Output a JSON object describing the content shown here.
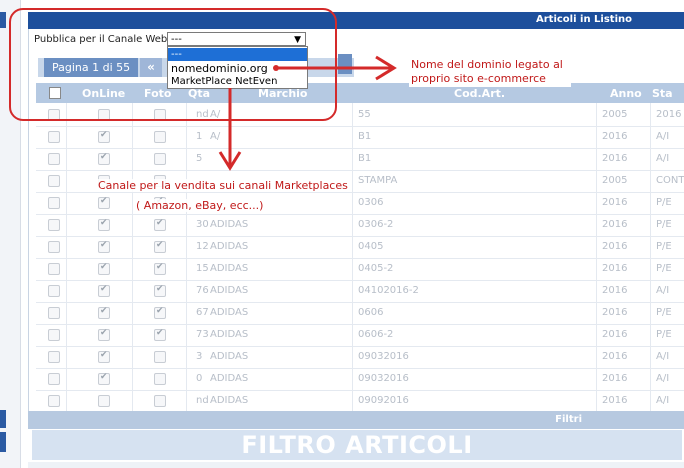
{
  "header": {
    "title": "Articoli in Listino"
  },
  "channel": {
    "label": "Pubblica per il Canale Web:",
    "selected": "---",
    "options": [
      "---",
      "nomedominio.org",
      "MarketPlace NetEven"
    ]
  },
  "pager": {
    "label": "Pagina 1 di 55",
    "prev": "«"
  },
  "table": {
    "columns": [
      "OnLine",
      "Foto",
      "Qta",
      "Marchio",
      "Cod.Art.",
      "Anno",
      "Sta"
    ],
    "rows": [
      {
        "qta": "nd",
        "marchio": "A/",
        "cod": "55",
        "anno": "2005",
        "stag": "2016",
        "online": false,
        "foto": false
      },
      {
        "qta": "1",
        "marchio": "A/",
        "cod": "B1",
        "anno": "2016",
        "stag": "A/I",
        "online": true,
        "foto": false
      },
      {
        "qta": "5",
        "marchio": "",
        "cod": "B1",
        "anno": "2016",
        "stag": "A/I",
        "online": true,
        "foto": false
      },
      {
        "qta": "",
        "marchio": "",
        "cod": "STAMPA",
        "anno": "2005",
        "stag": "CONTI",
        "online": false,
        "foto": false
      },
      {
        "qta": "",
        "marchio": "",
        "cod": "0306",
        "anno": "2016",
        "stag": "P/E",
        "online": true,
        "foto": true
      },
      {
        "qta": "30",
        "marchio": "ADIDAS",
        "cod": "0306-2",
        "anno": "2016",
        "stag": "P/E",
        "online": true,
        "foto": true
      },
      {
        "qta": "12",
        "marchio": "ADIDAS",
        "cod": "0405",
        "anno": "2016",
        "stag": "P/E",
        "online": true,
        "foto": true
      },
      {
        "qta": "15",
        "marchio": "ADIDAS",
        "cod": "0405-2",
        "anno": "2016",
        "stag": "P/E",
        "online": true,
        "foto": true
      },
      {
        "qta": "76",
        "marchio": "ADIDAS",
        "cod": "04102016-2",
        "anno": "2016",
        "stag": "A/I",
        "online": true,
        "foto": true
      },
      {
        "qta": "67",
        "marchio": "ADIDAS",
        "cod": "0606",
        "anno": "2016",
        "stag": "P/E",
        "online": true,
        "foto": true
      },
      {
        "qta": "73",
        "marchio": "ADIDAS",
        "cod": "0606-2",
        "anno": "2016",
        "stag": "P/E",
        "online": true,
        "foto": true
      },
      {
        "qta": "3",
        "marchio": "ADIDAS",
        "cod": "09032016",
        "anno": "2016",
        "stag": "A/I",
        "online": true,
        "foto": false
      },
      {
        "qta": "0",
        "marchio": "ADIDAS",
        "cod": "09032016",
        "anno": "2016",
        "stag": "A/I",
        "online": true,
        "foto": false
      },
      {
        "qta": "nd",
        "marchio": "ADIDAS",
        "cod": "09092016",
        "anno": "2016",
        "stag": "A/I",
        "online": false,
        "foto": false
      }
    ]
  },
  "filters": {
    "bar_title": "Filtri",
    "heading": "FILTRO ARTICOLI"
  },
  "annotations": {
    "dominio": "Nome del dominio legato al proprio sito e-commerce",
    "canale_line1": "Canale per la vendita sui canali Marketplaces",
    "canale_line2": "( Amazon, eBay, ecc...)",
    "color": "#c01818"
  }
}
